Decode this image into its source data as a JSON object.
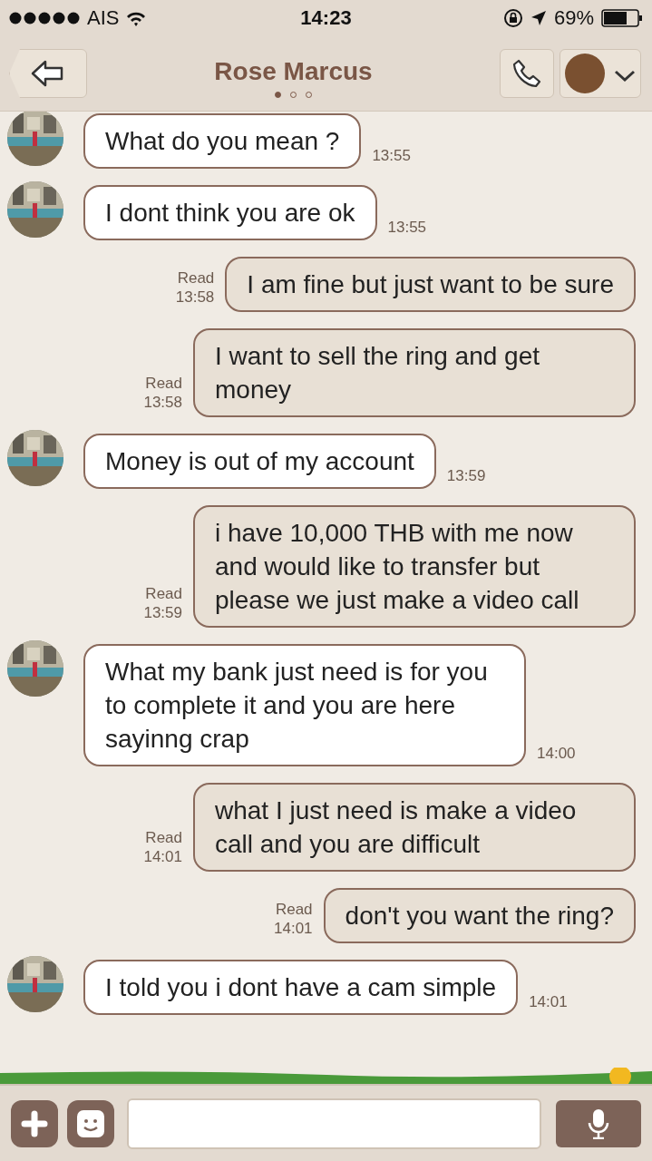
{
  "status_bar": {
    "carrier": "AIS",
    "time": "14:23",
    "battery": "69%"
  },
  "header": {
    "title": "Rose Marcus",
    "pages": [
      {
        "selected": true
      },
      {
        "selected": false
      },
      {
        "selected": false
      }
    ]
  },
  "messages": [
    {
      "kind": "incoming",
      "text": "What do you mean ?",
      "time": "13:55"
    },
    {
      "kind": "incoming",
      "text": "I dont think you are ok",
      "time": "13:55"
    },
    {
      "kind": "outgoing",
      "text": "I am fine but just want to be sure",
      "read": "Read",
      "time": "13:58"
    },
    {
      "kind": "outgoing",
      "text": "I want to sell the ring and get money",
      "read": "Read",
      "time": "13:58"
    },
    {
      "kind": "incoming",
      "text": "Money is out of my account",
      "time": "13:59"
    },
    {
      "kind": "outgoing",
      "text": "i have 10,000 THB with me now and would like to transfer but please we just make a video call",
      "read": "Read",
      "time": "13:59"
    },
    {
      "kind": "incoming",
      "text": "What my bank just need is for you to complete it and you are here sayinng crap",
      "time": "14:00"
    },
    {
      "kind": "outgoing",
      "text": "what I just need is make a video call and you are difficult",
      "read": "Read",
      "time": "14:01"
    },
    {
      "kind": "outgoing",
      "text": "don't you want the ring?",
      "read": "Read",
      "time": "14:01"
    },
    {
      "kind": "incoming",
      "text": "I told you i dont have a cam simple",
      "time": "14:01"
    }
  ]
}
